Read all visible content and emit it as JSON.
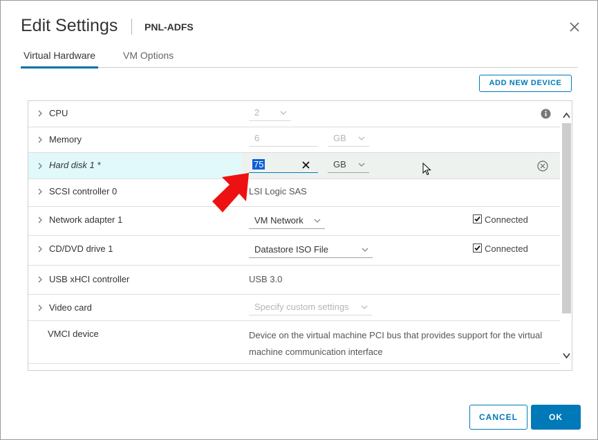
{
  "dialog": {
    "title": "Edit Settings",
    "vm_name": "PNL-ADFS",
    "close_icon": "close-icon"
  },
  "tabs": [
    {
      "label": "Virtual Hardware",
      "active": true
    },
    {
      "label": "VM Options",
      "active": false
    }
  ],
  "toolbar": {
    "add_device_label": "ADD NEW DEVICE"
  },
  "devices": {
    "cpu": {
      "label": "CPU",
      "value": "2"
    },
    "memory": {
      "label": "Memory",
      "value": "6",
      "unit": "GB"
    },
    "hard_disk": {
      "label": "Hard disk 1 *",
      "value": "75",
      "unit": "GB"
    },
    "scsi": {
      "label": "SCSI controller 0",
      "value": "LSI Logic SAS"
    },
    "network": {
      "label": "Network adapter 1",
      "value": "VM Network",
      "connected_label": "Connected",
      "connected": true
    },
    "cdrom": {
      "label": "CD/DVD drive 1",
      "value": "Datastore ISO File",
      "connected_label": "Connected",
      "connected": true
    },
    "usb": {
      "label": "USB xHCI controller",
      "value": "USB 3.0"
    },
    "video": {
      "label": "Video card",
      "value": "Specify custom settings"
    },
    "vmci": {
      "label": "VMCI device",
      "description": "Device on the virtual machine PCI bus that provides support for the virtual machine communication interface"
    }
  },
  "footer": {
    "cancel_label": "CANCEL",
    "ok_label": "OK"
  },
  "colors": {
    "accent": "#0079b8",
    "selected_row": "#e1f9fb",
    "highlight_row": "#eef2ee",
    "annotation_arrow": "#ee1111"
  }
}
